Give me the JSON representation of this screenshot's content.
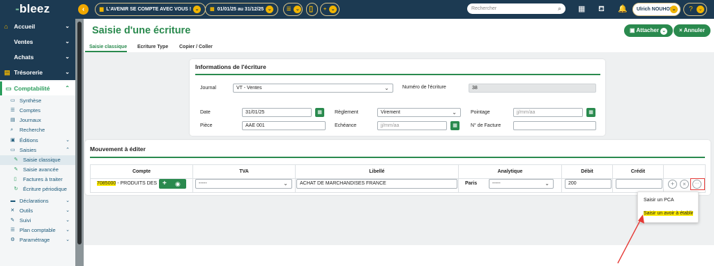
{
  "topbar": {
    "logo": "bleez",
    "dossier": "L'AVENIR SE COMPTE AVEC VOUS !",
    "period": "01/01/25 au 31/12/25",
    "search_placeholder": "Rechercher",
    "user": "Ulrich NOUHOU",
    "help": "?"
  },
  "sidebar": {
    "main_items": [
      {
        "label": "Accueil"
      },
      {
        "label": "Ventes"
      },
      {
        "label": "Achats"
      },
      {
        "label": "Trésorerie"
      }
    ],
    "section": {
      "label": "Comptabilité"
    },
    "items": [
      {
        "label": "Synthèse"
      },
      {
        "label": "Comptes"
      },
      {
        "label": "Journaux"
      },
      {
        "label": "Recherche"
      },
      {
        "label": "Éditions"
      },
      {
        "label": "Saisies"
      },
      {
        "label": "Saisie classique"
      },
      {
        "label": "Saisie avancée"
      },
      {
        "label": "Factures à traiter"
      },
      {
        "label": "Écriture périodique"
      },
      {
        "label": "Déclarations"
      },
      {
        "label": "Outils"
      },
      {
        "label": "Suivi"
      },
      {
        "label": "Plan comptable"
      },
      {
        "label": "Paramétrage"
      }
    ]
  },
  "page": {
    "title": "Saisie d'une écriture",
    "attach_label": "Attacher",
    "cancel_label": "Annuler",
    "tabs": [
      "Saisie classique",
      "Ecriture Type",
      "Copier / Coller"
    ]
  },
  "info": {
    "title": "Informations de l'écriture",
    "journal_label": "Journal",
    "journal_value": "VT - Ventes",
    "numero_label": "Numéro de l'écriture",
    "numero_value": "38",
    "date_label": "Date",
    "date_value": "31/01/25",
    "reglement_label": "Règlement",
    "reglement_value": "Virement",
    "pointage_label": "Pointage",
    "pointage_placeholder": "jj/mm/aa",
    "piece_label": "Pièce",
    "piece_value": "AAE 001",
    "echeance_label": "Echéance",
    "echeance_placeholder": "jj/mm/aa",
    "facture_label": "N° de Facture",
    "facture_value": ""
  },
  "mouvement": {
    "title": "Mouvement à éditer",
    "columns": [
      "Compte",
      "TVA",
      "Libellé",
      "Analytique",
      "Débit",
      "Crédit"
    ],
    "row": {
      "compte_number": "7085000",
      "compte_name": " - PRODUITS DES",
      "tva": "-----",
      "libelle": "ACHAT DE MARCHANDISES FRANCE",
      "analytique_label": "Paris",
      "analytique_value": "-----",
      "debit": "200",
      "credit": ""
    }
  },
  "menu": {
    "items": [
      "Saisir un PCA",
      "Saisir un avoir à établir"
    ]
  },
  "colors": {
    "navy": "#1c3a52",
    "green": "#2a8a4e",
    "yellow": "#f0b400",
    "highlight": "#ffeb00",
    "annotation_red": "#e53935"
  }
}
